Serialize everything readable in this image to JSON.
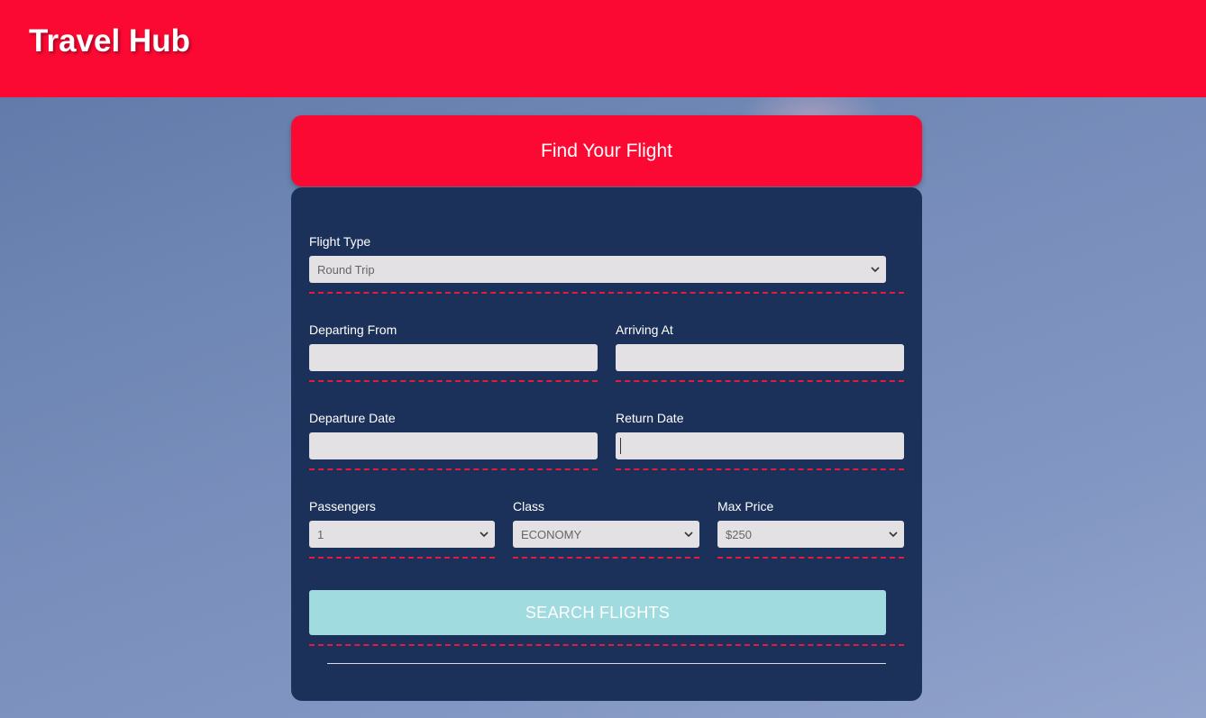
{
  "header": {
    "brand": "Travel Hub"
  },
  "form": {
    "title": "Find Your Flight",
    "flight_type": {
      "label": "Flight Type",
      "value": "Round Trip"
    },
    "departing_from": {
      "label": "Departing From",
      "value": ""
    },
    "arriving_at": {
      "label": "Arriving At",
      "value": ""
    },
    "departure_date": {
      "label": "Departure Date",
      "value": ""
    },
    "return_date": {
      "label": "Return Date",
      "value": ""
    },
    "passengers": {
      "label": "Passengers",
      "value": "1"
    },
    "class": {
      "label": "Class",
      "value": "ECONOMY"
    },
    "max_price": {
      "label": "Max Price",
      "value": "$250"
    },
    "search_label": "SEARCH FLIGHTS"
  },
  "colors": {
    "brand_red": "#fb0932",
    "card_navy": "#1c315a",
    "button_teal": "#a0dbe0",
    "dash_red": "#e6193f"
  }
}
